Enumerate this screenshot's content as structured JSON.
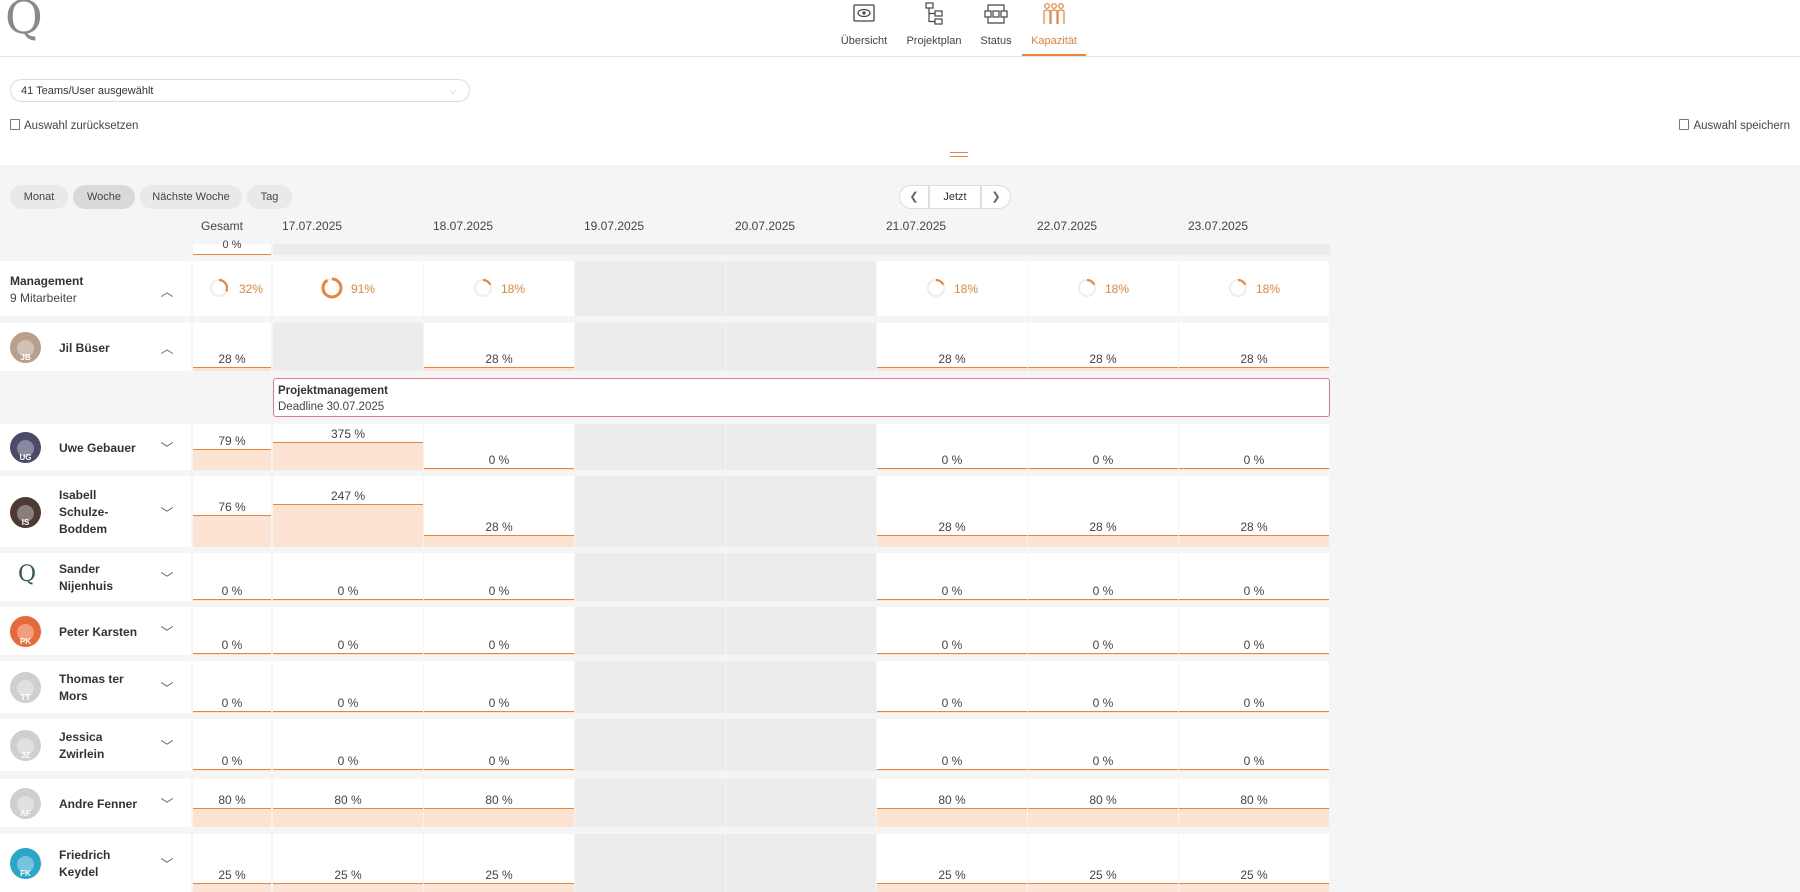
{
  "app": {
    "logo": "Q"
  },
  "nav": {
    "tabs": [
      {
        "label": "Übersicht",
        "icon": "eye-icon"
      },
      {
        "label": "Projektplan",
        "icon": "hierarchy-icon"
      },
      {
        "label": "Status",
        "icon": "status-flow-icon"
      },
      {
        "label": "Kapazität",
        "icon": "people-icon",
        "active": true
      }
    ]
  },
  "filter": {
    "team_select_value": "41 Teams/User ausgewählt",
    "reset_label": "Auswahl zurücksetzen",
    "save_label": "Auswahl speichern"
  },
  "view_modes": [
    {
      "label": "Monat"
    },
    {
      "label": "Woche",
      "active": true
    },
    {
      "label": "Nächste Woche"
    },
    {
      "label": "Tag"
    }
  ],
  "date_nav": {
    "today_label": "Jetzt"
  },
  "columns": {
    "total_header": "Gesamt",
    "dates": [
      "17.07.2025",
      "18.07.2025",
      "19.07.2025",
      "20.07.2025",
      "21.07.2025",
      "22.07.2025",
      "23.07.2025"
    ]
  },
  "partial_row": {
    "total": "0 %"
  },
  "team": {
    "name": "Management",
    "members": "9 Mitarbeiter",
    "total": "32%",
    "total_fraction": 0.32,
    "days": [
      {
        "value": "91%",
        "fraction": 0.91
      },
      {
        "value": "18%",
        "fraction": 0.18
      },
      null,
      null,
      {
        "value": "18%",
        "fraction": 0.18
      },
      {
        "value": "18%",
        "fraction": 0.18
      },
      {
        "value": "18%",
        "fraction": 0.18
      }
    ]
  },
  "task": {
    "title": "Projektmanagement",
    "deadline": "Deadline 30.07.2025"
  },
  "colors": {
    "accent": "#e8843b",
    "bar_fill": "#fde3d2",
    "task_border": "#e27a8a"
  },
  "people": [
    {
      "name": "Jil Büser",
      "initials": "JB",
      "expanded": true,
      "total": "28 %",
      "total_fraction": 0.09,
      "days": [
        "",
        "28 %",
        null,
        null,
        "28 %",
        "28 %",
        "28 %"
      ],
      "fractions": [
        0,
        0.09,
        0,
        0,
        0.09,
        0.09,
        0.09
      ]
    },
    {
      "name": "Uwe Gebauer",
      "initials": "UG",
      "total": "79 %",
      "total_fraction": 0.45,
      "days": [
        "375 %",
        "0 %",
        null,
        null,
        "0 %",
        "0 %",
        "0 %"
      ],
      "fractions": [
        0.6,
        0.02,
        0,
        0,
        0.02,
        0.02,
        0.02
      ]
    },
    {
      "name": "Isabell Schulze-Boddem",
      "initials": "IS",
      "total": "76 %",
      "total_fraction": 0.45,
      "days": [
        "247 %",
        "28 %",
        null,
        null,
        "28 %",
        "28 %",
        "28 %"
      ],
      "fractions": [
        0.6,
        0.17,
        0,
        0,
        0.17,
        0.17,
        0.17
      ]
    },
    {
      "name": "Sander Nijenhuis",
      "initials": "Q",
      "total": "0 %",
      "total_fraction": 0.02,
      "days": [
        "0 %",
        "0 %",
        null,
        null,
        "0 %",
        "0 %",
        "0 %"
      ],
      "fractions": [
        0.02,
        0.02,
        0,
        0,
        0.02,
        0.02,
        0.02
      ]
    },
    {
      "name": "Peter Karsten",
      "initials": "PK",
      "total": "0 %",
      "total_fraction": 0.02,
      "days": [
        "0 %",
        "0 %",
        null,
        null,
        "0 %",
        "0 %",
        "0 %"
      ],
      "fractions": [
        0.02,
        0.02,
        0,
        0,
        0.02,
        0.02,
        0.02
      ]
    },
    {
      "name": "Thomas ter Mors",
      "initials": "TT",
      "total": "0 %",
      "total_fraction": 0.02,
      "days": [
        "0 %",
        "0 %",
        null,
        null,
        "0 %",
        "0 %",
        "0 %"
      ],
      "fractions": [
        0.02,
        0.02,
        0,
        0,
        0.02,
        0.02,
        0.02
      ]
    },
    {
      "name": "Jessica Zwirlein",
      "initials": "JZ",
      "total": "0 %",
      "total_fraction": 0.02,
      "days": [
        "0 %",
        "0 %",
        null,
        null,
        "0 %",
        "0 %",
        "0 %"
      ],
      "fractions": [
        0.02,
        0.02,
        0,
        0,
        0.02,
        0.02,
        0.02
      ]
    },
    {
      "name": "Andre Fenner",
      "initials": "AF",
      "total": "80 %",
      "total_fraction": 0.4,
      "days": [
        "80 %",
        "80 %",
        null,
        null,
        "80 %",
        "80 %",
        "80 %"
      ],
      "fractions": [
        0.4,
        0.4,
        0,
        0,
        0.4,
        0.4,
        0.4
      ]
    },
    {
      "name": "Friedrich Keydel",
      "initials": "FK",
      "total": "25 %",
      "total_fraction": 0.15,
      "days": [
        "25 %",
        "25 %",
        null,
        null,
        "25 %",
        "25 %",
        "25 %"
      ],
      "fractions": [
        0.15,
        0.15,
        0,
        0,
        0.15,
        0.15,
        0.15
      ]
    }
  ]
}
